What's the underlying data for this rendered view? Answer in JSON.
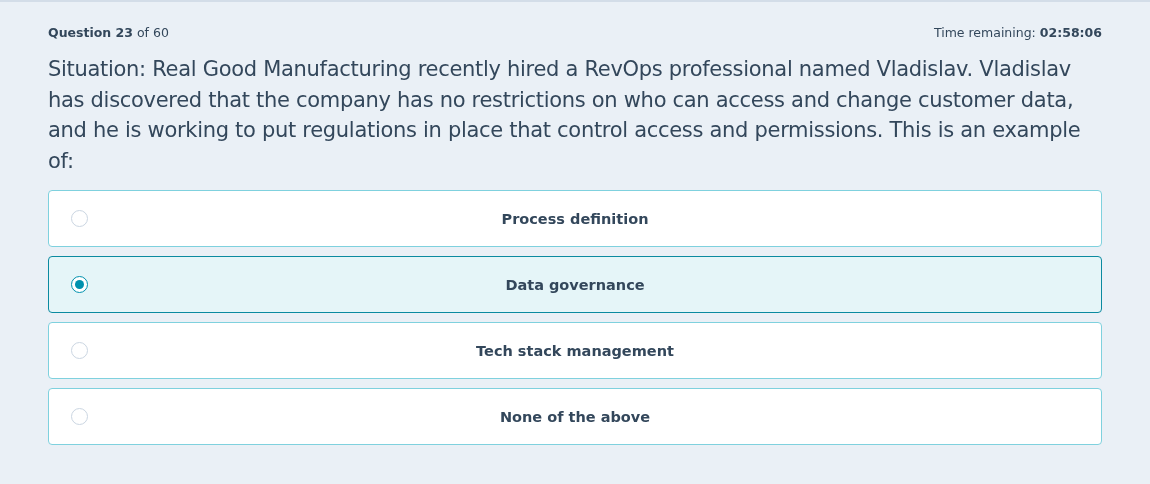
{
  "progress": "**Question 23** of 60",
  "timer": "Time remaining: **02:58:06**",
  "question": "Situation: Real Good Manufacturing recently hired a RevOps professional named Vladislav. Vladislav has discovered that the company has no restrictions on who can access and change customer data, and he is working to put regulations in place that control access and permissions. This is an example of:",
  "options": [
    {
      "label": "Process definition",
      "selected": false
    },
    {
      "label": "Data governance",
      "selected": true
    },
    {
      "label": "Tech stack management",
      "selected": false
    },
    {
      "label": "None of the above",
      "selected": false
    }
  ]
}
